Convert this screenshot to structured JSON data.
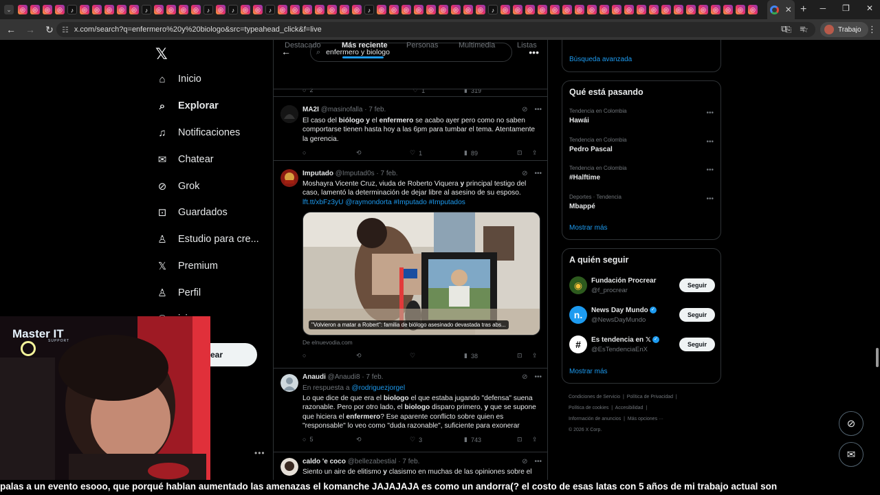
{
  "browser": {
    "url": "x.com/search?q=enfermero%20y%20biologo&src=typeahead_click&f=live",
    "profile_label": "Trabajo"
  },
  "nav": {
    "items": [
      {
        "label": "Inicio",
        "icon": "home-icon"
      },
      {
        "label": "Explorar",
        "icon": "search-icon"
      },
      {
        "label": "Notificaciones",
        "icon": "bell-icon"
      },
      {
        "label": "Chatear",
        "icon": "mail-icon"
      },
      {
        "label": "Grok",
        "icon": "grok-icon"
      },
      {
        "label": "Guardados",
        "icon": "bookmark-icon"
      },
      {
        "label": "Estudio para cre...",
        "icon": "studio-icon"
      },
      {
        "label": "Premium",
        "icon": "x-icon"
      },
      {
        "label": "Perfil",
        "icon": "person-icon"
      },
      {
        "label": "iciones",
        "icon": "communities-icon"
      }
    ],
    "post_label": "ear"
  },
  "search": {
    "query": "enfermero y biologo",
    "tabs": [
      "Destacado",
      "Más reciente",
      "Personas",
      "Multimedia",
      "Listas"
    ],
    "active_tab": "Más reciente"
  },
  "tweets": [
    {
      "name": "MA2I",
      "handle": "@masinofalla",
      "date": "7 feb.",
      "body_html": "El caso del <b>biólogo y</b> el <b>enfermero</b> se acabo ayer pero como no saben comportarse tienen hasta hoy a las 6pm para tumbar el tema. Atentamente la gerencia.",
      "likes": "1",
      "views": "89"
    },
    {
      "name": "Imputado",
      "handle": "@Imputad0s",
      "date": "7 feb.",
      "body_html": "Moshayra Vicente Cruz, viuda de Roberto Viquera <b>y</b> principal testigo del caso, lamentó la determinación de dejar libre al asesino de su esposo.",
      "links": "lft.tt/xbFz3yU @raymondorta #Imputado #Imputados",
      "media_caption": "\"Volvieron a matar a Robert\": familia de biólogo asesinado devastada tras abs...",
      "source": "De elnuevodia.com",
      "views": "38"
    },
    {
      "name": "Anaudi",
      "handle": "@Anaudi8",
      "date": "7 feb.",
      "reply_to_label": "En respuesta a",
      "reply_to": "@rodriguezjorgel",
      "body_html": "Lo que dice de que era el <b>biologo</b> el que estaba jugando \"defensa\" suena razonable. Pero por otro lado, el <b>biologo</b> disparo primero, <b>y</b> que se supone que hiciera el <b>enfermero</b>?  Ese aparente conflicto sobre quien es \"responsable\" lo veo como \"duda razonable\", suficiente para exonerar",
      "replies": "5",
      "likes": "3",
      "views": "743"
    },
    {
      "name": "caldo 'e coco",
      "handle": "@bellezabestial",
      "date": "7 feb.",
      "body_html": "Siento un aire de elitismo <b>y</b> clasismo en muchas de las opiniones sobre el"
    }
  ],
  "top_partial": {
    "likes": "1",
    "replies": "2",
    "views": "319"
  },
  "right": {
    "advanced_search": "Búsqueda avanzada",
    "trends_title": "Qué está pasando",
    "trends": [
      {
        "context": "Tendencia en Colombia",
        "name": "Hawái"
      },
      {
        "context": "Tendencia en Colombia",
        "name": "Pedro Pascal"
      },
      {
        "context": "Tendencia en Colombia",
        "name": "#Halftime"
      },
      {
        "context": "Deportes · Tendencia",
        "name": "Mbappé"
      }
    ],
    "show_more": "Mostrar más",
    "follow_title": "A quién seguir",
    "follow": [
      {
        "name": "Fundación Procrear",
        "handle": "@f_procrear",
        "verified": false
      },
      {
        "name": "News Day Mundo",
        "handle": "@NewsDayMundo",
        "verified": true
      },
      {
        "name": "Es tendencia en 𝕏",
        "handle": "@EsTendenciaEnX",
        "verified": true
      }
    ],
    "follow_button": "Seguir",
    "footer": [
      "Condiciones de Servicio",
      "Política de Privacidad",
      "Política de cookies",
      "Accesibilidad",
      "Información de anuncios",
      "Más opciones ···",
      "© 2026 X Corp."
    ]
  },
  "overlay": {
    "cam_logo": "Master IT",
    "cam_sub": "SUPPORT",
    "subtitles": "palas a un evento  esooo, que porqué hablan aumentado las amenazas  el komanche JAJAJAJA  es como un andorra(?  el costo de esas latas con 5 años de mi trabajo actual  son"
  },
  "colors": {
    "accent": "#1d9bf0",
    "bg": "#000000",
    "border": "#2f3336"
  }
}
